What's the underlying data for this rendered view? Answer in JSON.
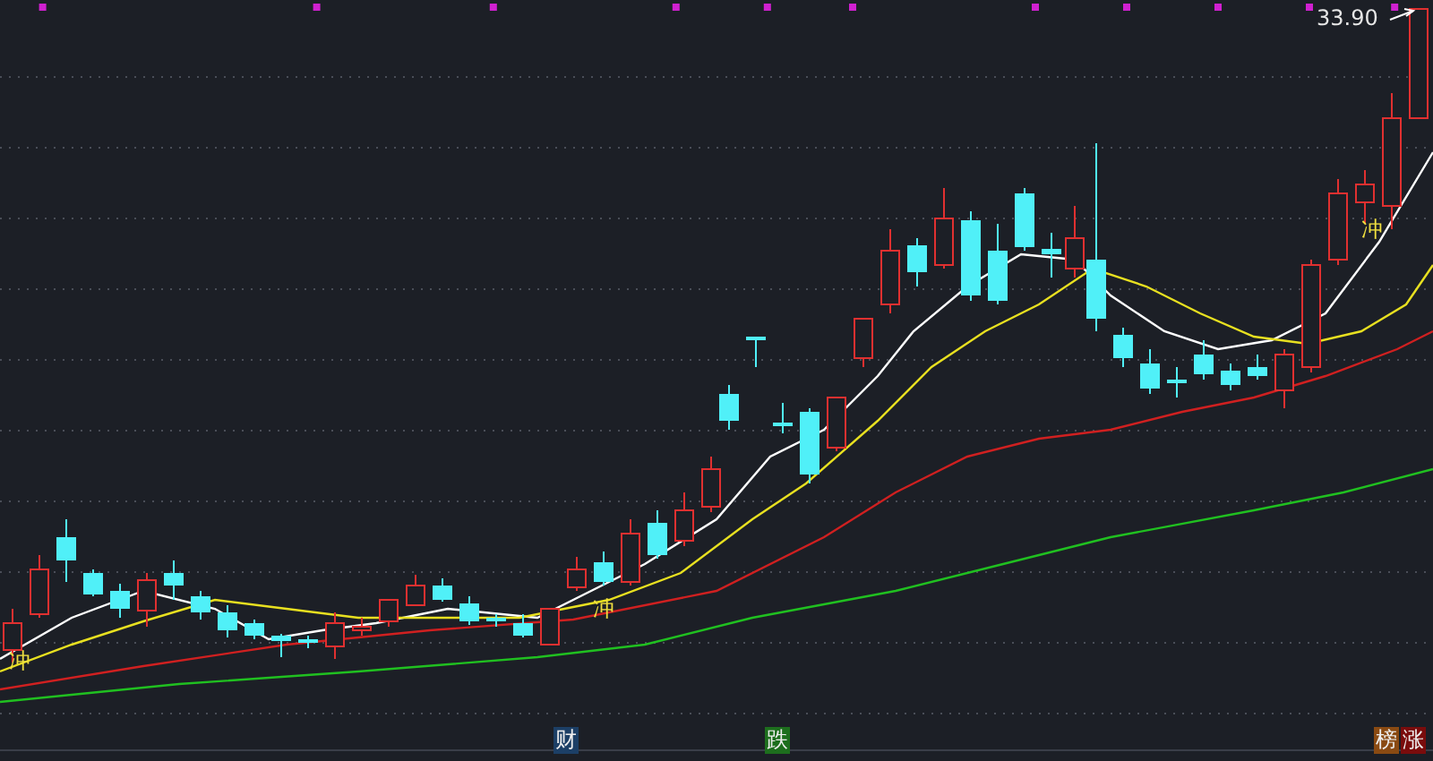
{
  "price_label": "33.90",
  "signals": [
    {
      "text": "冲"
    },
    {
      "text": "冲"
    },
    {
      "text": "冲"
    }
  ],
  "event_badges": [
    {
      "text": "财",
      "color": "#1c3f66"
    },
    {
      "text": "跌",
      "color": "#1d6e1d"
    },
    {
      "text": "榜",
      "color": "#8a4a12"
    },
    {
      "text": "涨",
      "color": "#7a0c0c"
    }
  ]
}
